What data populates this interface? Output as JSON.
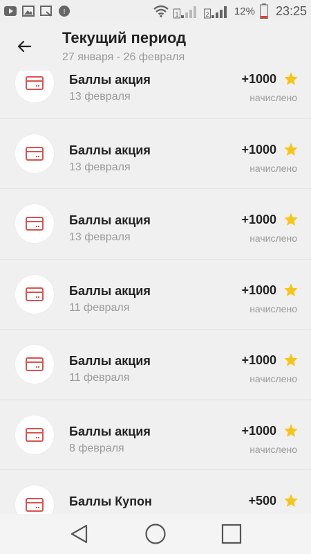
{
  "status_bar": {
    "battery_percent": "12%",
    "time": "23:25",
    "icons": [
      "youtube-icon",
      "gallery-icon",
      "screenshot-icon",
      "update-icon",
      "wifi-icon",
      "sim1-signal-icon",
      "sim2-signal-icon",
      "battery-icon"
    ]
  },
  "header": {
    "title": "Текущий период",
    "subtitle": "27 января - 26 февраля"
  },
  "colors": {
    "accent_icon": "#d9534f",
    "star": "#f5c518",
    "muted_text": "#9a9a9a"
  },
  "transactions": [
    {
      "title": "Баллы акция",
      "date": "13 февраля",
      "amount": "+1000",
      "status": "начислено"
    },
    {
      "title": "Баллы акция",
      "date": "13 февраля",
      "amount": "+1000",
      "status": "начислено"
    },
    {
      "title": "Баллы акция",
      "date": "13 февраля",
      "amount": "+1000",
      "status": "начислено"
    },
    {
      "title": "Баллы акция",
      "date": "11 февраля",
      "amount": "+1000",
      "status": "начислено"
    },
    {
      "title": "Баллы акция",
      "date": "11 февраля",
      "amount": "+1000",
      "status": "начислено"
    },
    {
      "title": "Баллы акция",
      "date": "8 февраля",
      "amount": "+1000",
      "status": "начислено"
    },
    {
      "title": "Баллы Купон",
      "date": "",
      "amount": "+500",
      "status": ""
    }
  ]
}
